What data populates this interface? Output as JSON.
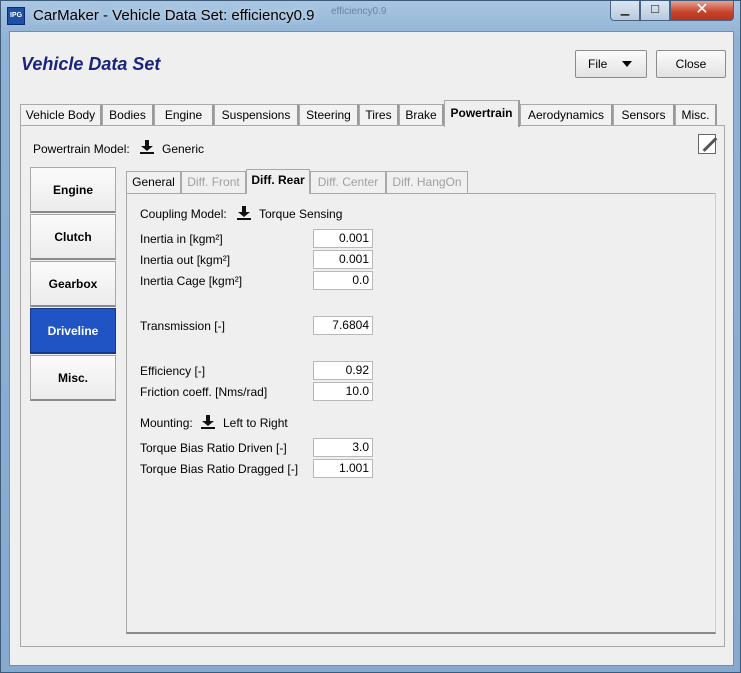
{
  "window": {
    "title": "CarMaker - Vehicle Data Set: efficiency0.9",
    "icon_text": "IPG",
    "ghost_text": "efficiency0.9"
  },
  "header": {
    "title": "Vehicle Data Set",
    "file_label": "File",
    "close_label": "Close"
  },
  "main_tabs": [
    {
      "label": "Vehicle Body"
    },
    {
      "label": "Bodies"
    },
    {
      "label": "Engine"
    },
    {
      "label": "Suspensions"
    },
    {
      "label": "Steering"
    },
    {
      "label": "Tires"
    },
    {
      "label": "Brake"
    },
    {
      "label": "Powertrain"
    },
    {
      "label": "Aerodynamics"
    },
    {
      "label": "Sensors"
    },
    {
      "label": "Misc."
    }
  ],
  "powertrain": {
    "model_label": "Powertrain Model:",
    "model_value": "Generic"
  },
  "side_nav": [
    {
      "label": "Engine"
    },
    {
      "label": "Clutch"
    },
    {
      "label": "Gearbox"
    },
    {
      "label": "Driveline"
    },
    {
      "label": "Misc."
    }
  ],
  "sub_tabs": [
    {
      "label": "General"
    },
    {
      "label": "Diff. Front"
    },
    {
      "label": "Diff. Rear"
    },
    {
      "label": "Diff. Center"
    },
    {
      "label": "Diff. HangOn"
    }
  ],
  "form": {
    "coupling_label": "Coupling Model:",
    "coupling_value": "Torque Sensing",
    "inertia_in_label": "Inertia in [kgm²]",
    "inertia_in_value": "0.001",
    "inertia_out_label": "Inertia out [kgm²]",
    "inertia_out_value": "0.001",
    "inertia_cage_label": "Inertia Cage [kgm²]",
    "inertia_cage_value": "0.0",
    "transmission_label": "Transmission [-]",
    "transmission_value": "7.6804",
    "efficiency_label": "Efficiency [-]",
    "efficiency_value": "0.92",
    "friction_label": "Friction coeff. [Nms/rad]",
    "friction_value": "10.0",
    "mounting_label": "Mounting:",
    "mounting_value": "Left to Right",
    "tbr_driven_label": "Torque Bias Ratio Driven [-]",
    "tbr_driven_value": "3.0",
    "tbr_dragged_label": "Torque Bias Ratio Dragged [-]",
    "tbr_dragged_value": "1.001"
  }
}
